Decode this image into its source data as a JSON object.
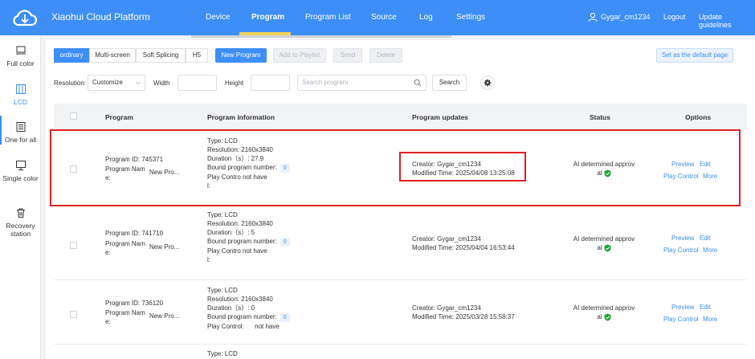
{
  "nav": {
    "brand": "Xiaohui Cloud Platform",
    "items": [
      "Device",
      "Program",
      "Program List",
      "Source",
      "Log",
      "Settings"
    ],
    "active": "Program",
    "user": "Gygar_cm1234",
    "logout": "Logout",
    "update": "Update guidelines"
  },
  "sidebar": {
    "items": [
      {
        "label": "Full color",
        "icon": "monitor-icon"
      },
      {
        "label": "LCD",
        "icon": "lcd-panel-icon"
      },
      {
        "label": "One for all",
        "icon": "list-icon"
      },
      {
        "label": "Single color",
        "icon": "monitor-stand-icon"
      },
      {
        "label": "Recovery station",
        "icon": "trash-icon"
      }
    ],
    "active": "LCD"
  },
  "toolbar": {
    "segments": [
      "ordinary",
      "Multi-screen",
      "Soft Splicing",
      "H5"
    ],
    "active_segment": "ordinary",
    "new_program": "New Program",
    "add_to_playlist": "Add to Playlist",
    "send": "Send",
    "delete": "Delete",
    "default_page": "Set as the default page"
  },
  "filters": {
    "resolution_label": "Resolution:",
    "resolution_value": "Customize",
    "width_label": "Width",
    "height_label": "Height",
    "search_placeholder": "Search program",
    "search_button": "Search"
  },
  "table": {
    "headers": [
      "Program",
      "Program information",
      "Program updates",
      "Status",
      "Options"
    ],
    "rows": [
      {
        "id_label": "Program ID:",
        "id": "745371",
        "name_label": "Program Nam",
        "name_label2": "e:",
        "name": "New Pro...",
        "type": "Type: LCD",
        "resolution": "Resolution:  2160x3840",
        "duration": "Duration（s）: 27.9",
        "bound": "Bound program number:",
        "bound_count": "0",
        "play_control_label": "Play Contro",
        "play_control_label2": "l:",
        "play_control": "not have",
        "creator": "Creator:  Gygar_cm1234",
        "modified": "Modified Time:  2025/04/08 13:25:08",
        "status1": "AI determined approv",
        "status2": "al",
        "preview": "Preview",
        "edit": "Edit",
        "play": "Play Control",
        "more": "More"
      },
      {
        "id_label": "Program ID:",
        "id": "741710",
        "name_label": "Program Nam",
        "name_label2": "e:",
        "name": "New Pro...",
        "type": "Type: LCD",
        "resolution": "Resolution:  2160x3840",
        "duration": "Duration（s）: 5",
        "bound": "Bound program number:",
        "bound_count": "0",
        "play_control_label": "Play Contro",
        "play_control_label2": "l:",
        "play_control": "not have",
        "creator": "Creator:  Gygar_cm1234",
        "modified": "Modified Time:  2025/04/04 16:53:44",
        "status1": "AI determined approv",
        "status2": "al",
        "preview": "Preview",
        "edit": "Edit",
        "play": "Play Control",
        "more": "More"
      },
      {
        "id_label": "Program ID:",
        "id": "736120",
        "name_label": "Program Nam",
        "name_label2": "e:",
        "name": "New Pro...",
        "type": "Type: LCD",
        "resolution": "Resolution:  2160x3840",
        "duration": "Duration（s）: 0",
        "bound": "Bound program number:",
        "bound_count": "0",
        "play_control_label": "Play Control:",
        "play_control_label2": "",
        "play_control": "not have",
        "creator": "Creator:  Gygar_cm1234",
        "modified": "Modified Time:  2025/03/28 15:58:37",
        "status1": "AI determined approv",
        "status2": "al",
        "preview": "Preview",
        "edit": "Edit",
        "play": "Play Control",
        "more": "More"
      },
      {
        "type": "Type: LCD"
      }
    ]
  },
  "colors": {
    "primary": "#3d8ef7",
    "highlight": "#e02020",
    "approved": "#1fa33a"
  }
}
